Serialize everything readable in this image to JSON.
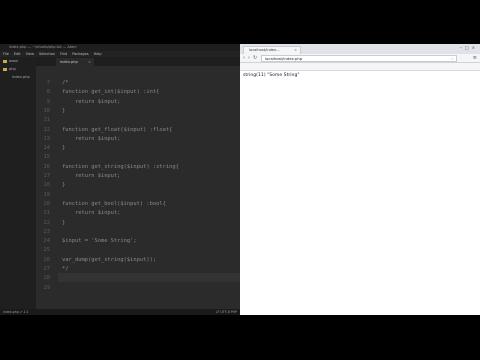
{
  "editor": {
    "title": "index.php — ~/vhosts/php-tut — Atom",
    "menu": [
      "File",
      "Edit",
      "View",
      "Selection",
      "Find",
      "Packages",
      "Help"
    ],
    "sidebar": {
      "root": "www",
      "folder": "php",
      "file": "index.php"
    },
    "tab_label": "index.php",
    "lines": [
      {
        "n": "7",
        "code": "/*"
      },
      {
        "n": "8",
        "code": "function get_int($input) :int{"
      },
      {
        "n": "9",
        "code": "    return $input;"
      },
      {
        "n": "10",
        "code": "}"
      },
      {
        "n": "11",
        "code": ""
      },
      {
        "n": "12",
        "code": "function get_float($input) :float{"
      },
      {
        "n": "13",
        "code": "    return $input;"
      },
      {
        "n": "14",
        "code": "}"
      },
      {
        "n": "15",
        "code": ""
      },
      {
        "n": "16",
        "code": "function get_string($input) :string{"
      },
      {
        "n": "17",
        "code": "    return $input;"
      },
      {
        "n": "18",
        "code": "}"
      },
      {
        "n": "19",
        "code": ""
      },
      {
        "n": "20",
        "code": "function get_bool($input) :bool{"
      },
      {
        "n": "21",
        "code": "    return $input;"
      },
      {
        "n": "22",
        "code": "}"
      },
      {
        "n": "23",
        "code": ""
      },
      {
        "n": "24",
        "code": "$input = 'Some String';"
      },
      {
        "n": "25",
        "code": ""
      },
      {
        "n": "26",
        "code": "var_dump(get_string($input));"
      },
      {
        "n": "27",
        "code": "*/"
      },
      {
        "n": "28",
        "code": ""
      },
      {
        "n": "29",
        "code": ""
      }
    ],
    "status_left": "index.php",
    "status_mid": "1:1",
    "status_right": "LF  UTF-8  PHP"
  },
  "browser": {
    "tab_title": "localhost/index...",
    "url": "localhost/index.php",
    "bookmarks": [
      "Apps",
      "YouTube",
      "Gmail",
      "My Bookmarks",
      "Facebook",
      "Twitter",
      "Hangouts",
      "Network",
      "Reddit",
      "YouTube Channel"
    ],
    "bookmark_colors": [
      "#4a7cd6",
      "#d93025",
      "#d93025",
      "#f2b400",
      "#3b5998",
      "#1da1f2",
      "#0f9d58",
      "#888888",
      "#ff4500",
      "#d93025"
    ],
    "output_text": "string(11) \"Some String\""
  }
}
